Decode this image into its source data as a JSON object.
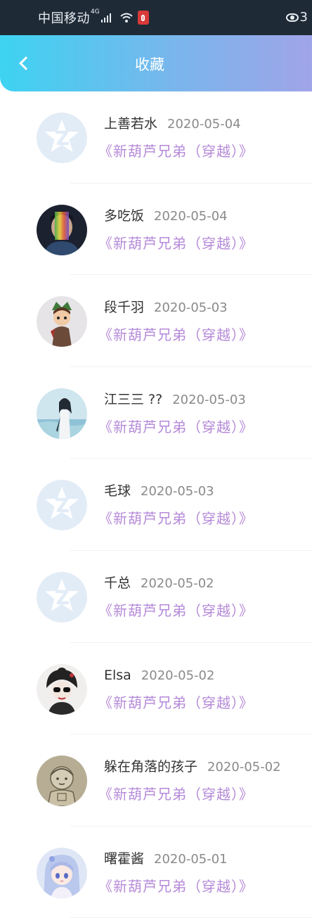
{
  "status_bar": {
    "carrier": "中国移动",
    "network": "4G",
    "battery_digit": "3"
  },
  "header": {
    "title": "收藏"
  },
  "favorites": [
    {
      "user": "上善若水",
      "date": "2020-05-04",
      "title": "《新葫芦兄弟（穿越）》",
      "avatar": "default-avatar"
    },
    {
      "user": "多吃饭",
      "date": "2020-05-04",
      "title": "《新葫芦兄弟（穿越）》",
      "avatar": "user-photo"
    },
    {
      "user": "段千羽",
      "date": "2020-05-03",
      "title": "《新葫芦兄弟（穿越）》",
      "avatar": "user-photo"
    },
    {
      "user": "江三三 ??",
      "date": "2020-05-03",
      "title": "《新葫芦兄弟（穿越）》",
      "avatar": "user-photo"
    },
    {
      "user": "毛球",
      "date": "2020-05-03",
      "title": "《新葫芦兄弟（穿越）》",
      "avatar": "default-avatar"
    },
    {
      "user": "千总",
      "date": "2020-05-02",
      "title": "《新葫芦兄弟（穿越）》",
      "avatar": "default-avatar"
    },
    {
      "user": "Elsa",
      "date": "2020-05-02",
      "title": "《新葫芦兄弟（穿越）》",
      "avatar": "user-photo"
    },
    {
      "user": "躲在角落的孩子",
      "date": "2020-05-02",
      "title": "《新葫芦兄弟（穿越）》",
      "avatar": "user-photo"
    },
    {
      "user": "曙霍酱",
      "date": "2020-05-01",
      "title": "《新葫芦兄弟（穿越）》",
      "avatar": "user-photo"
    }
  ],
  "colors": {
    "header_gradient_start": "#3dd3f1",
    "header_gradient_end": "#a0a4e8",
    "title_link": "#b58ad8",
    "date_text": "#8a8a8a",
    "status_bar_bg": "#1f2a37"
  }
}
